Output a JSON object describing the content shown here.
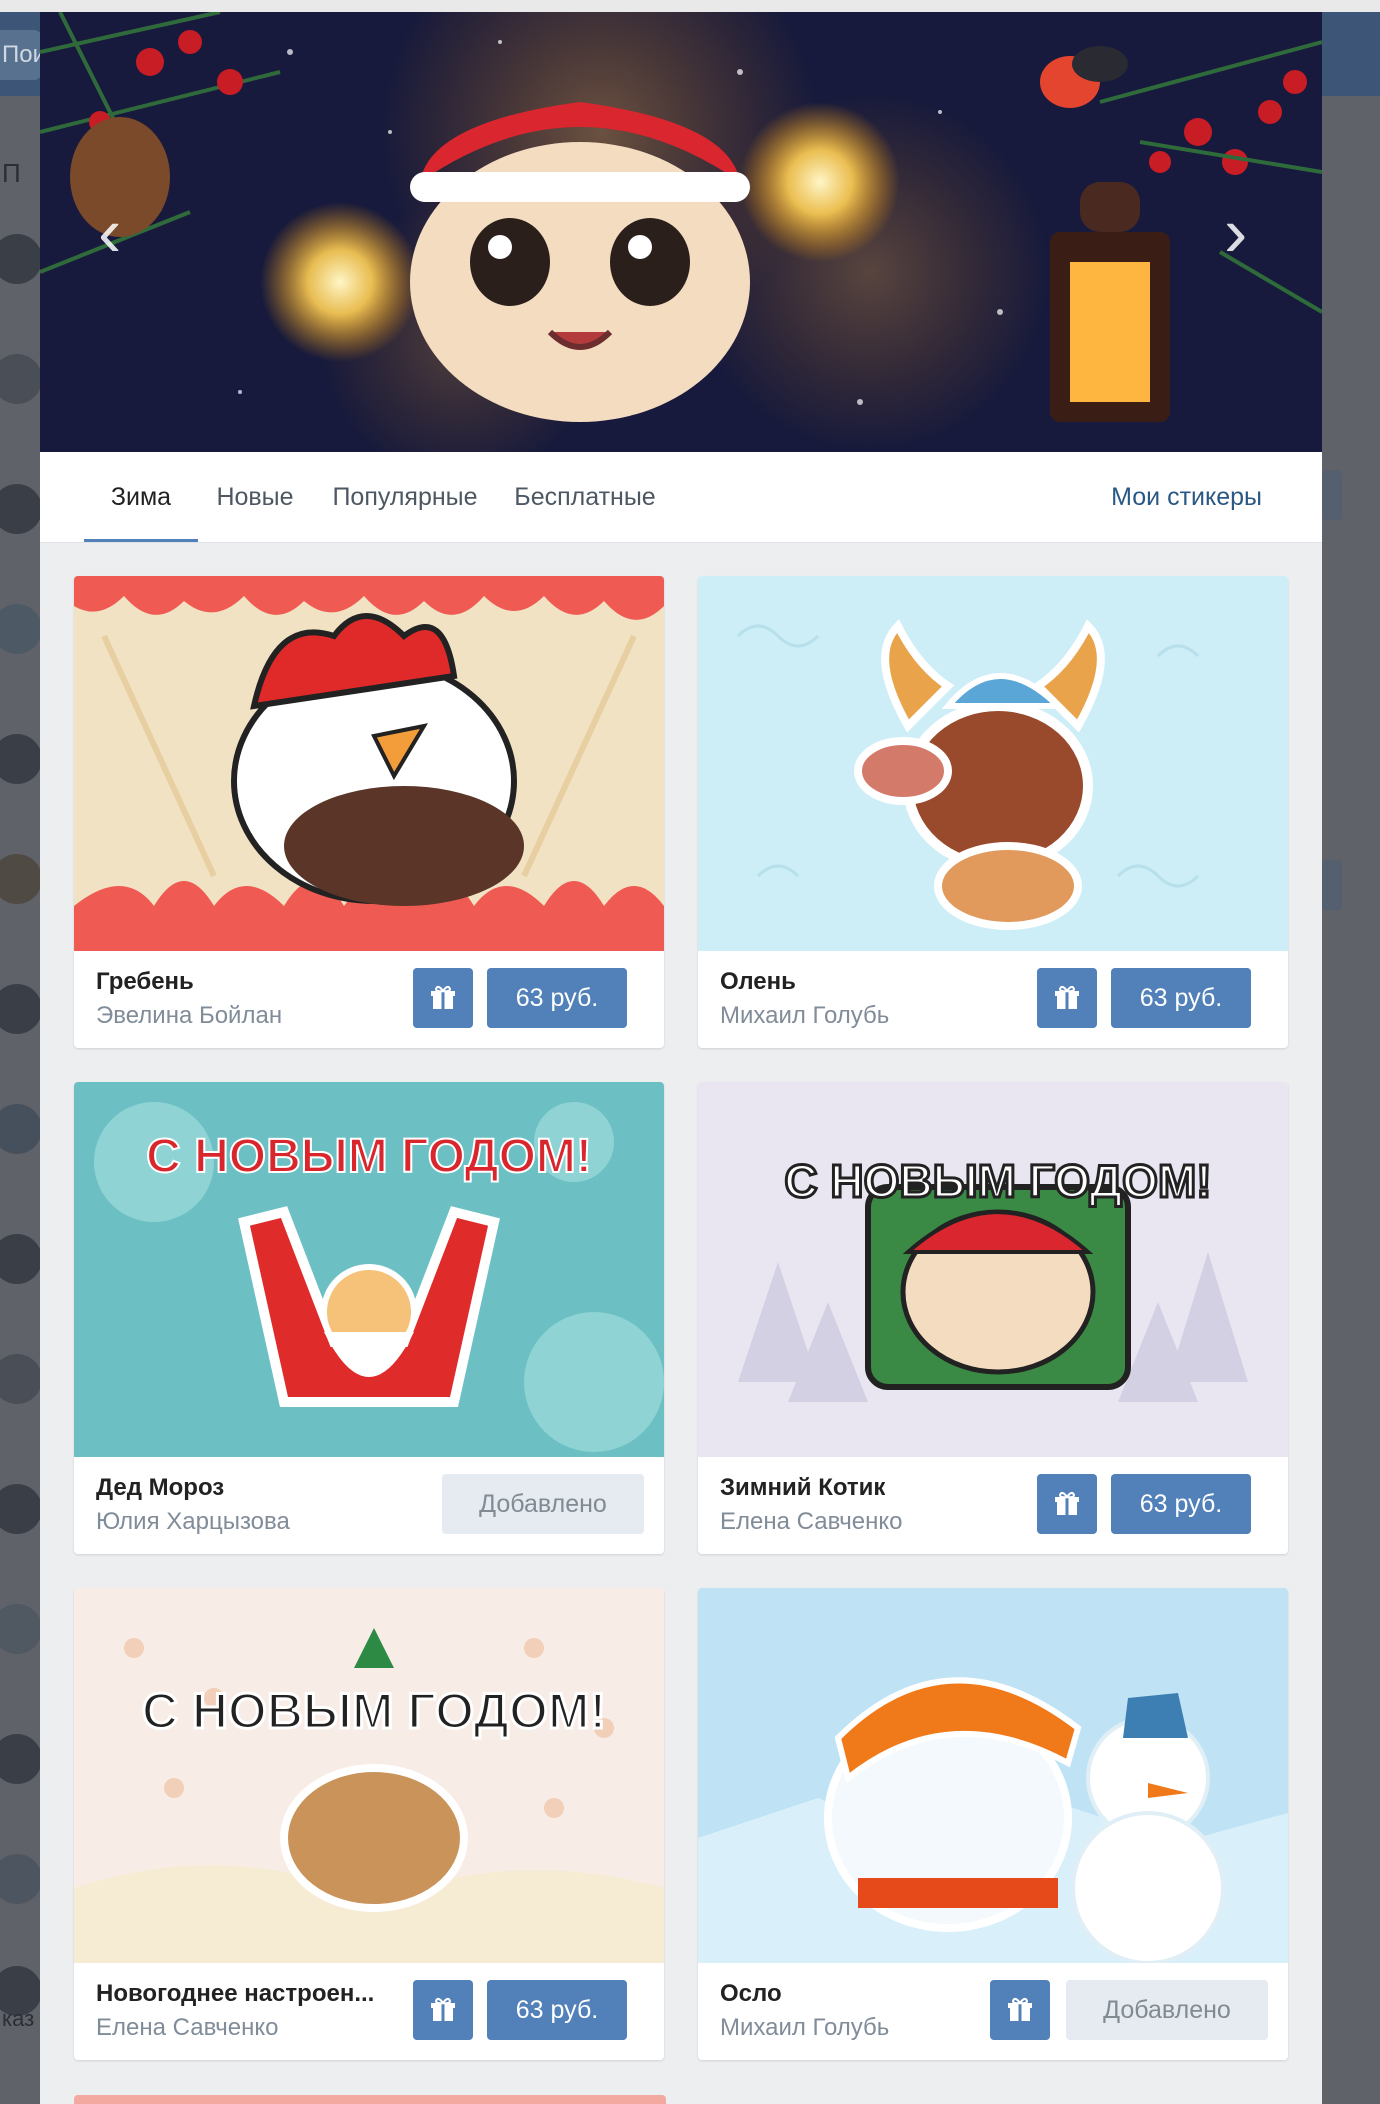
{
  "background": {
    "search_text": "Пои",
    "left_text_1": "П",
    "left_text_2": "каз"
  },
  "tabs": [
    {
      "label": "Зима",
      "active": true
    },
    {
      "label": "Новые",
      "active": false
    },
    {
      "label": "Популярные",
      "active": false
    },
    {
      "label": "Бесплатные",
      "active": false
    }
  ],
  "my_stickers_label": "Мои стикеры",
  "gift_icon": "gift-icon",
  "colors": {
    "accent": "#5181b8",
    "link": "#2a5885",
    "added_bg": "#e5ebf1"
  },
  "packs": [
    {
      "title": "Гребень",
      "author": "Эвелина Бойлан",
      "price": "63 руб.",
      "status": "buy",
      "art_text": ""
    },
    {
      "title": "Олень",
      "author": "Михаил Голубь",
      "price": "63 руб.",
      "status": "buy",
      "art_text": ""
    },
    {
      "title": "Дед Мороз",
      "author": "Юлия Харцызова",
      "added": "Добавлено",
      "status": "added",
      "art_text": "С НОВЫМ ГОДОМ!"
    },
    {
      "title": "Зимний Котик",
      "author": "Елена Савченко",
      "price": "63 руб.",
      "status": "buy",
      "art_text": "С НОВЫМ ГОДОМ!"
    },
    {
      "title": "Новогоднее настроен...",
      "author": "Елена Савченко",
      "price": "63 руб.",
      "status": "buy",
      "art_text": "С НОВЫМ ГОДОМ!"
    },
    {
      "title": "Осло",
      "author": "Михаил Голубь",
      "added": "Добавлено",
      "status": "added-gift",
      "art_text": ""
    }
  ]
}
